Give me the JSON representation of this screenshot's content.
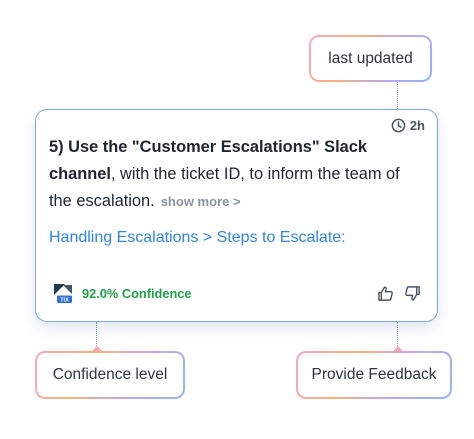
{
  "tags": {
    "last_updated": "last updated",
    "confidence_level": "Confidence level",
    "provide_feedback": "Provide Feedback"
  },
  "card": {
    "timestamp": "2h",
    "answer_bold": "5) Use the \"Customer Escalations\" Slack channel",
    "answer_rest": ", with the ticket ID, to inform the team of the escalation.",
    "show_more": "show more >",
    "source_link": "Handling Escalations > Steps to Escalate:",
    "confidence": "92.0% Confidence",
    "source_logo_text": "TIX"
  },
  "colors": {
    "accent_blue": "#2f86e6",
    "confidence_green": "#1fa34a",
    "card_border": "#7fa7e8"
  },
  "icons": [
    "clock-icon",
    "zendesk-logo-icon",
    "thumbs-up-icon",
    "thumbs-down-icon"
  ]
}
